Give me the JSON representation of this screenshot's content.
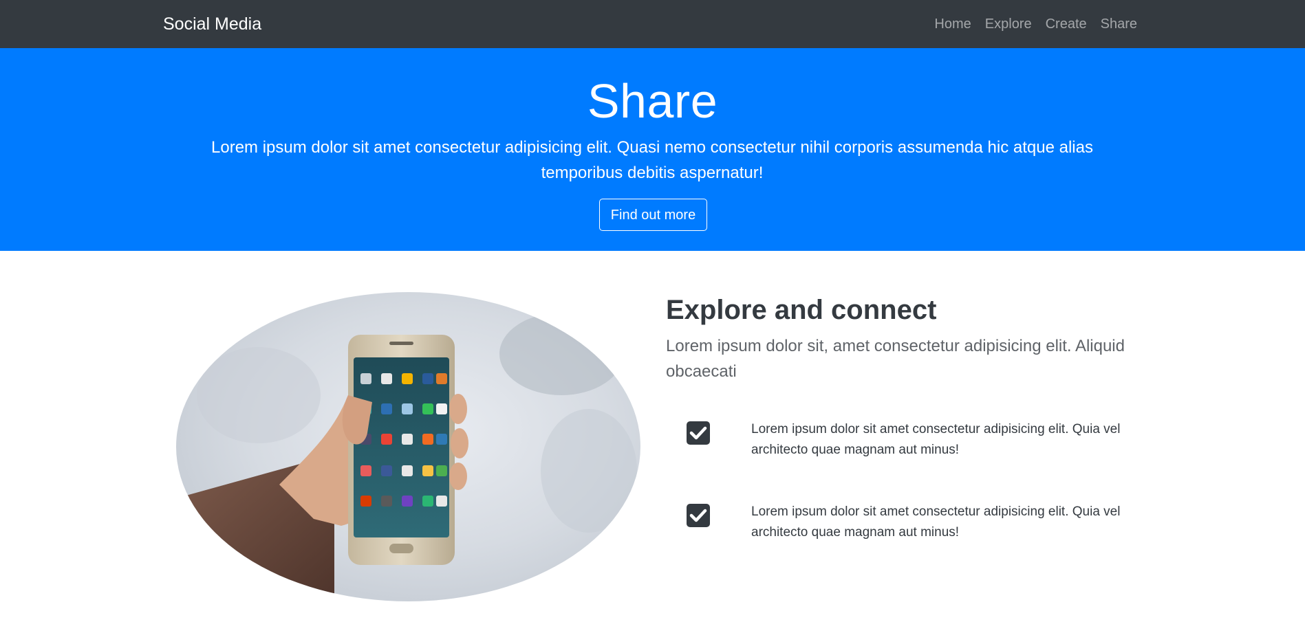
{
  "navbar": {
    "brand": "Social Media",
    "links": [
      "Home",
      "Explore",
      "Create",
      "Share"
    ]
  },
  "hero": {
    "title": "Share",
    "text": "Lorem ipsum dolor sit amet consectetur adipisicing elit. Quasi nemo consectetur nihil corporis assumenda hic atque alias temporibus debitis aspernatur!",
    "button_label": "Find out more"
  },
  "feature": {
    "title": "Explore and connect",
    "lead": "Lorem ipsum dolor sit, amet consectetur adipisicing elit. Aliquid obcaecati",
    "items": [
      {
        "text": "Lorem ipsum dolor sit amet consectetur adipisicing elit. Quia vel architecto quae magnam aut minus!",
        "icon": "check-square-icon"
      },
      {
        "text": "Lorem ipsum dolor sit amet consectetur adipisicing elit. Quia vel architecto quae magnam aut minus!",
        "icon": "check-square-icon"
      }
    ]
  },
  "colors": {
    "navbar_bg": "#343a40",
    "hero_bg": "#007bff",
    "text_dark": "#343a40"
  }
}
